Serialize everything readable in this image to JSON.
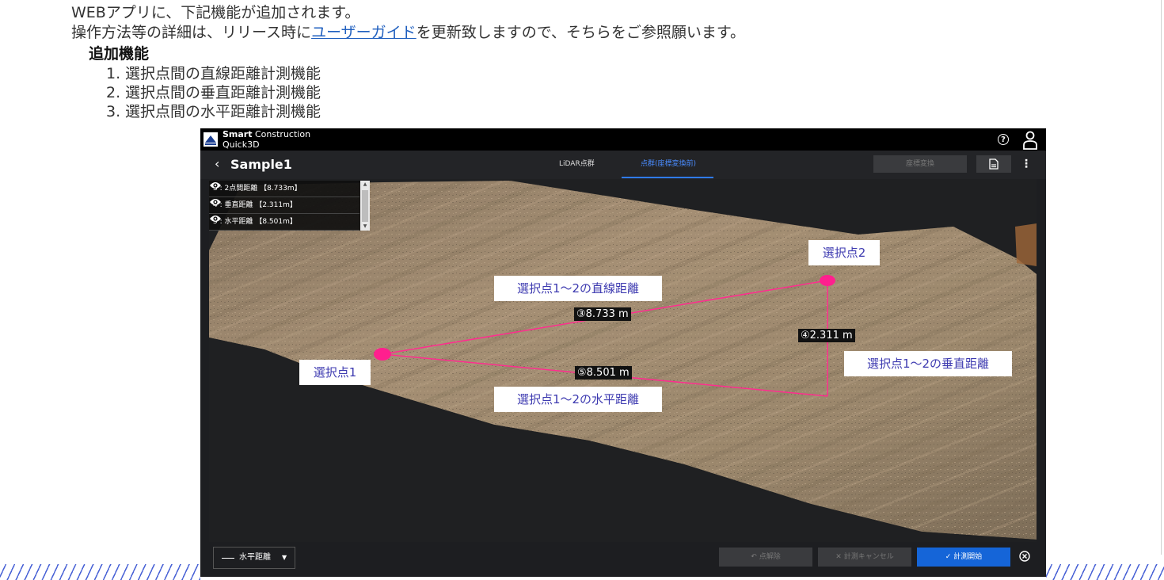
{
  "doc": {
    "line1": "WEBアプリに、下記機能が追加されます。",
    "line2_before": "操作方法等の詳細は、リリース時に",
    "line2_link": "ユーザーガイド",
    "line2_after": "を更新致しますので、そちらをご参照願います。",
    "heading": "追加機能",
    "features": [
      {
        "num": "1.",
        "text": "選択点間の直線距離計測機能"
      },
      {
        "num": "2.",
        "text": "選択点間の垂直距離計測機能"
      },
      {
        "num": "3.",
        "text": "選択点間の水平距離計測機能"
      }
    ]
  },
  "app": {
    "brand_bold": "Smart",
    "brand_light": " Construction",
    "product": "Quick3D",
    "help_glyph": "?",
    "back_glyph": "‹",
    "project_title": "Sample1",
    "tabs": [
      {
        "label": "LiDAR点群",
        "active": false
      },
      {
        "label": "点群(座標変換前)",
        "active": true
      }
    ],
    "convert_button": "座標変換",
    "more_glyph": "⋮",
    "measurements": [
      {
        "label": "3 : 2点間距離 【8.733m】"
      },
      {
        "label": "4 : 垂直距離 【2.311m】"
      },
      {
        "label": "5 : 水平距離 【8.501m】"
      }
    ],
    "distance_labels": {
      "straight": "③8.733 m",
      "vertical": "④2.311 m",
      "horizontal": "⑤8.501 m"
    },
    "callouts": {
      "point1": "選択点1",
      "point2": "選択点2",
      "straight": "選択点1～2の直線距離",
      "vertical": "選択点1～2の垂直距離",
      "horizontal": "選択点1～2の水平距離"
    },
    "bottom": {
      "mode": "水平距離",
      "caret": "▼",
      "undo": "↶ 点解除",
      "cancel": "✕ 計測キャンセル",
      "start": "✓ 計測開始"
    },
    "colors": {
      "accent": "#1565d8",
      "measure_line": "#ff2d8f",
      "point": "#ff1f8e",
      "terrain": "#a08a6e"
    }
  }
}
